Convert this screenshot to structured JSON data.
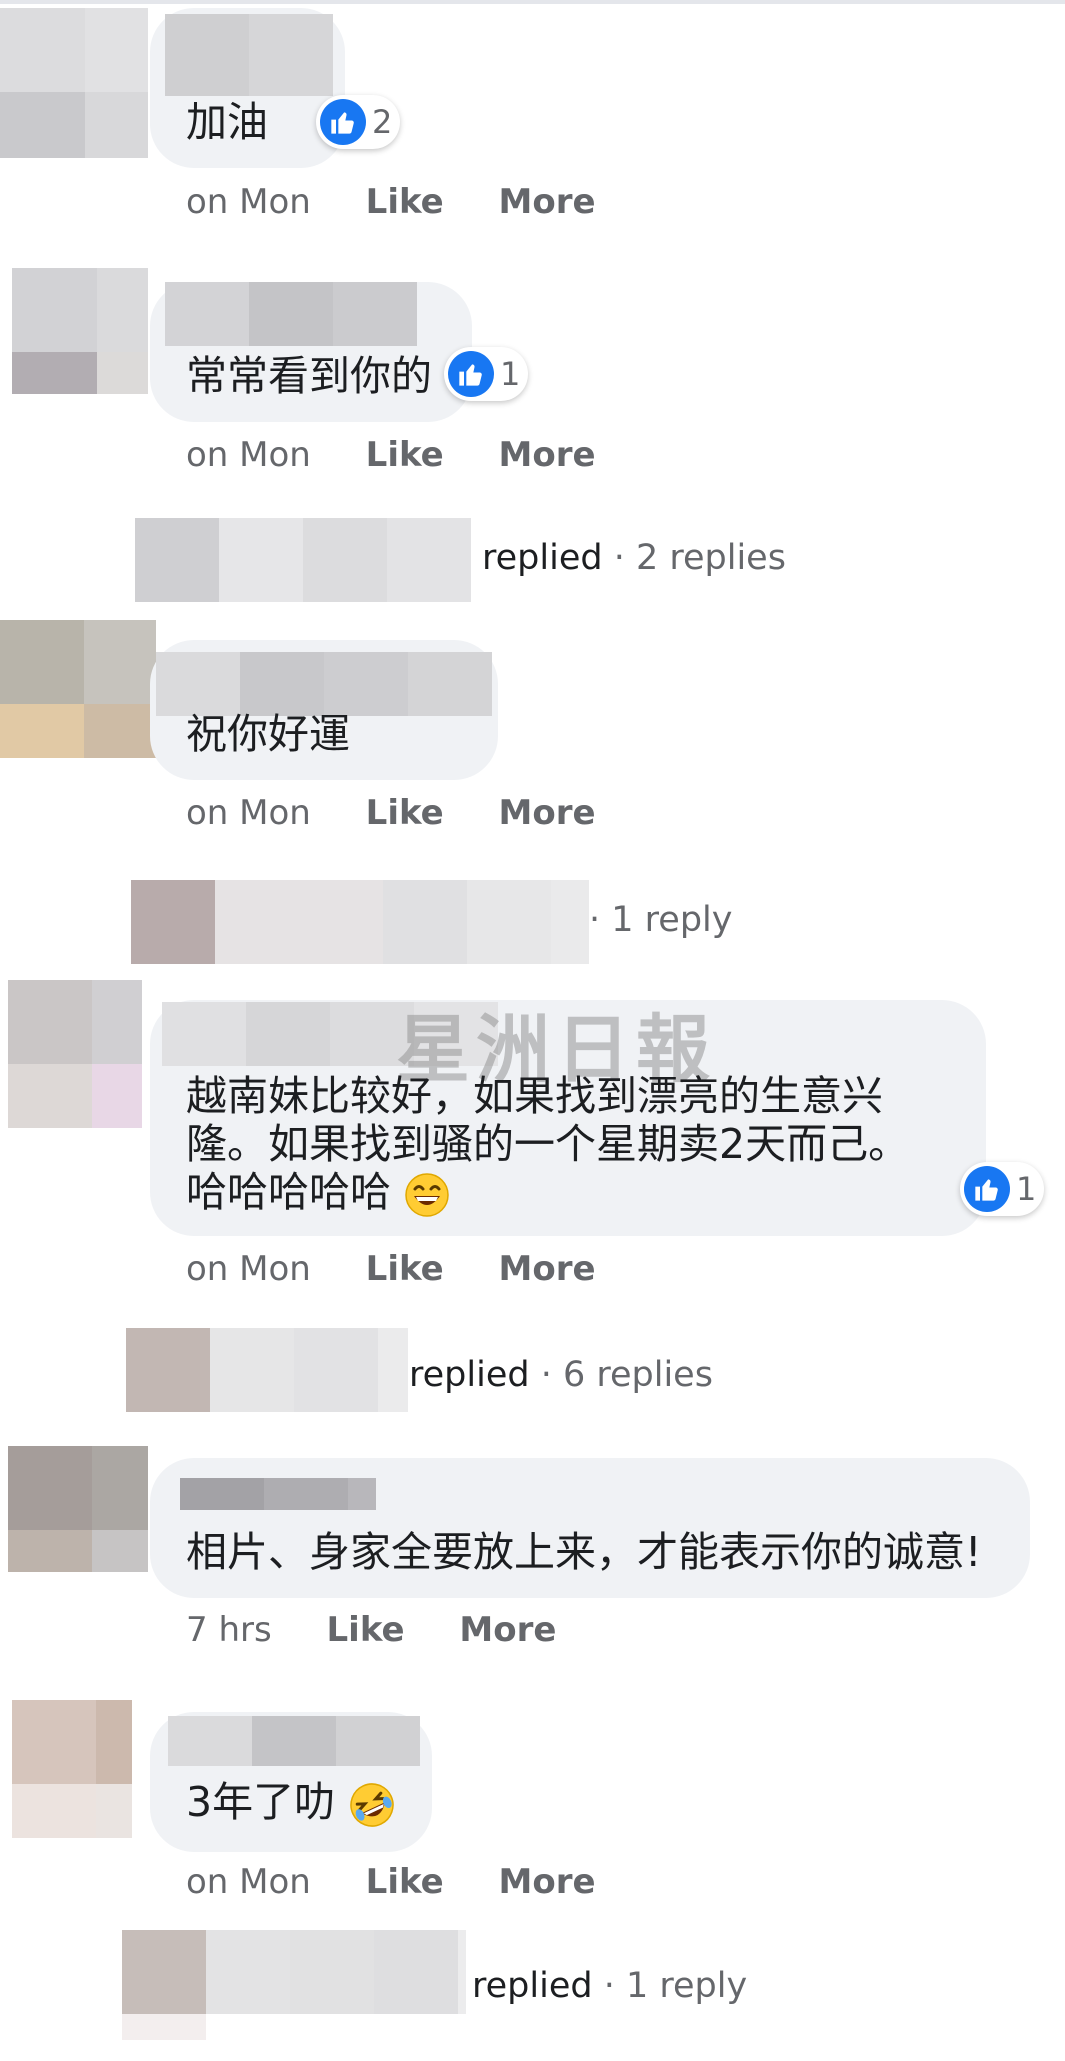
{
  "watermark": "星洲日報",
  "comments": [
    {
      "text": "加油",
      "reaction": {
        "icon": "like-icon",
        "count": "2"
      },
      "time": "on Mon",
      "like": "Like",
      "more": "More"
    },
    {
      "text": "常常看到你的",
      "reaction": {
        "icon": "like-icon",
        "count": "1"
      },
      "time": "on Mon",
      "like": "Like",
      "more": "More",
      "replies": {
        "word": "replied",
        "sep": " · ",
        "count_text": "2 replies"
      }
    },
    {
      "text": "祝你好運",
      "time": "on Mon",
      "like": "Like",
      "more": "More",
      "replies": {
        "word": "",
        "sep": " · ",
        "count_text": "1 reply"
      }
    },
    {
      "lines": [
        "越南妹比较好，如果找到漂亮的生意兴",
        "隆。如果找到骚的一个星期卖2天而己。",
        "哈哈哈哈哈"
      ],
      "emoji": "grinning-face-emoji",
      "reaction": {
        "icon": "like-icon",
        "count": "1"
      },
      "time": "on Mon",
      "like": "Like",
      "more": "More",
      "replies": {
        "word": "replied",
        "sep": " · ",
        "count_text": "6 replies"
      }
    },
    {
      "text": "相片、身家全要放上来，才能表示你的诚意!",
      "time": "7 hrs",
      "like": "Like",
      "more": "More"
    },
    {
      "text": "3年了叻",
      "emoji": "rolling-laughing-emoji",
      "time": "on Mon",
      "like": "Like",
      "more": "More",
      "replies": {
        "word": "replied",
        "sep": " · ",
        "count_text": "1 reply"
      }
    }
  ],
  "colors": {
    "bubble": "#f0f2f5",
    "like_blue": "#1877f2",
    "meta_gray": "#65676b",
    "text": "#1c1e21"
  }
}
